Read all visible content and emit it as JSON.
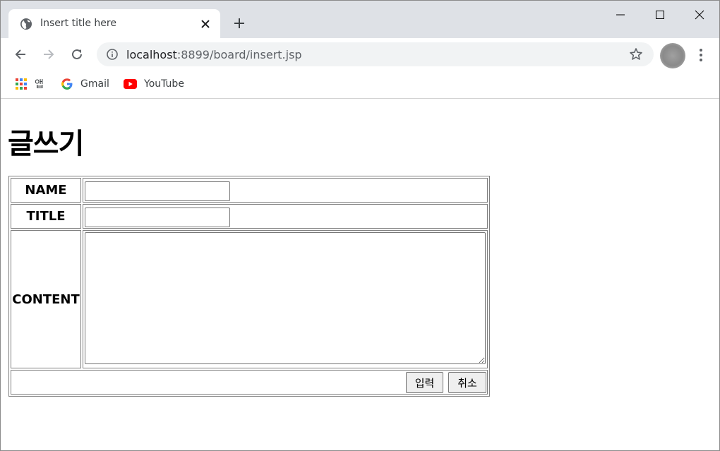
{
  "browser": {
    "tab_title": "Insert title here",
    "url_host": "localhost",
    "url_rest": ":8899/board/insert.jsp",
    "bookmarks": [
      {
        "label": "앱",
        "icon": "apps-grid-icon"
      },
      {
        "label": "Gmail",
        "icon": "google-g-icon"
      },
      {
        "label": "YouTube",
        "icon": "youtube-icon"
      }
    ]
  },
  "page": {
    "heading": "글쓰기",
    "form": {
      "name_label": "NAME",
      "title_label": "TITLE",
      "content_label": "CONTENT",
      "name_value": "",
      "title_value": "",
      "content_value": "",
      "submit_label": "입력",
      "cancel_label": "취소"
    }
  },
  "colors": {
    "tabstrip_bg": "#dee1e6",
    "omnibox_bg": "#f1f3f4",
    "youtube_red": "#ff0000"
  }
}
